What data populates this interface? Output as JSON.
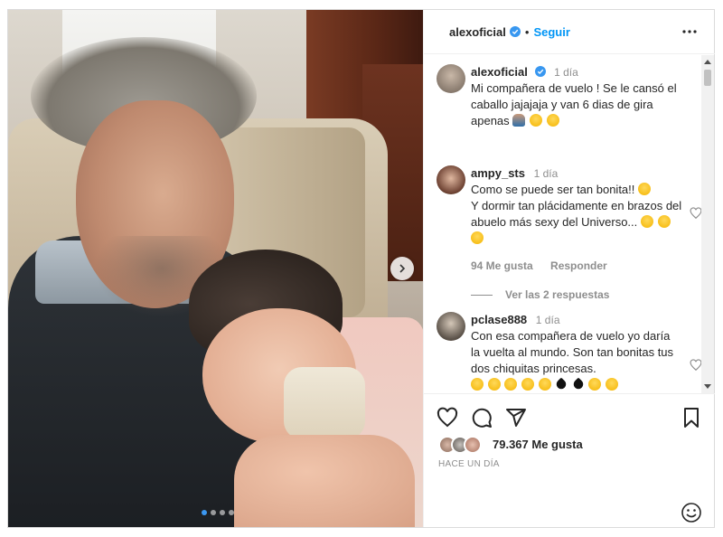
{
  "post": {
    "author": "alexoficial",
    "follow_label": "Seguir",
    "separator": "•"
  },
  "caption": {
    "user": "alexoficial",
    "time": "1 día",
    "text": "Mi compañera de vuelo ! Se le cansó el caballo jajajaja y van 6 dias de gira apenas",
    "emoji": [
      "man-shrugging",
      "laughing-face",
      "laughing-face"
    ]
  },
  "comments": [
    {
      "user": "ampy_sts",
      "time": "1 día",
      "text": "Como se puede ser tan bonita!!",
      "text2": "Y dormir tan plácidamente en brazos del abuelo más sexy del Universo...",
      "likes": "94 Me gusta",
      "reply_label": "Responder",
      "view_replies": "Ver las 2 respuestas"
    },
    {
      "user": "pclase888",
      "time": "1 día",
      "text": "Con esa compañera de vuelo yo daría la vuelta al mundo. Son tan bonitas tus dos chiquitas princesas."
    }
  ],
  "likes_text": "79.367 Me gusta",
  "time_ago": "HACE UN DÍA",
  "icons": [
    "more-icon",
    "heart-icon",
    "comment-icon",
    "share-icon",
    "save-icon",
    "emoji-icon",
    "next-arrow-icon",
    "verified-icon"
  ],
  "colors": {
    "link": "#0095f6",
    "verified": "#3897f0",
    "text": "#262626",
    "muted": "#8e8e8e"
  },
  "carousel": {
    "slides": 4,
    "active": 1
  }
}
